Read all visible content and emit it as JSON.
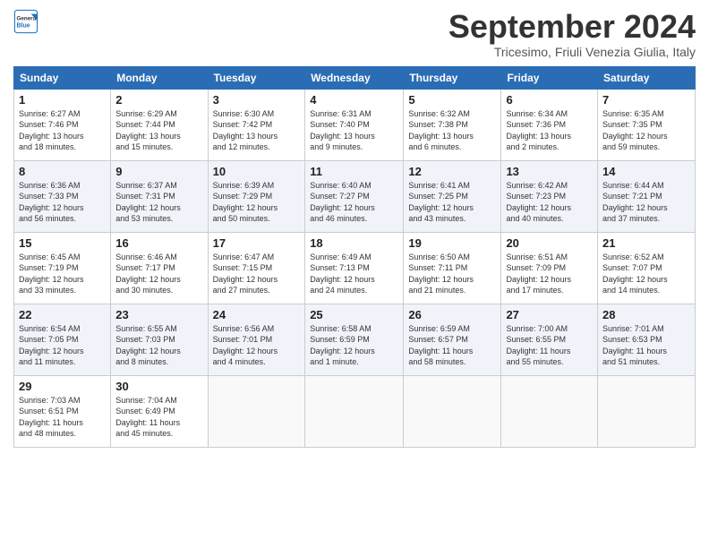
{
  "header": {
    "logo_line1": "General",
    "logo_line2": "Blue",
    "month": "September 2024",
    "location": "Tricesimo, Friuli Venezia Giulia, Italy"
  },
  "days_of_week": [
    "Sunday",
    "Monday",
    "Tuesday",
    "Wednesday",
    "Thursday",
    "Friday",
    "Saturday"
  ],
  "weeks": [
    [
      {
        "day": "1",
        "lines": [
          "Sunrise: 6:27 AM",
          "Sunset: 7:46 PM",
          "Daylight: 13 hours",
          "and 18 minutes."
        ]
      },
      {
        "day": "2",
        "lines": [
          "Sunrise: 6:29 AM",
          "Sunset: 7:44 PM",
          "Daylight: 13 hours",
          "and 15 minutes."
        ]
      },
      {
        "day": "3",
        "lines": [
          "Sunrise: 6:30 AM",
          "Sunset: 7:42 PM",
          "Daylight: 13 hours",
          "and 12 minutes."
        ]
      },
      {
        "day": "4",
        "lines": [
          "Sunrise: 6:31 AM",
          "Sunset: 7:40 PM",
          "Daylight: 13 hours",
          "and 9 minutes."
        ]
      },
      {
        "day": "5",
        "lines": [
          "Sunrise: 6:32 AM",
          "Sunset: 7:38 PM",
          "Daylight: 13 hours",
          "and 6 minutes."
        ]
      },
      {
        "day": "6",
        "lines": [
          "Sunrise: 6:34 AM",
          "Sunset: 7:36 PM",
          "Daylight: 13 hours",
          "and 2 minutes."
        ]
      },
      {
        "day": "7",
        "lines": [
          "Sunrise: 6:35 AM",
          "Sunset: 7:35 PM",
          "Daylight: 12 hours",
          "and 59 minutes."
        ]
      }
    ],
    [
      {
        "day": "8",
        "lines": [
          "Sunrise: 6:36 AM",
          "Sunset: 7:33 PM",
          "Daylight: 12 hours",
          "and 56 minutes."
        ]
      },
      {
        "day": "9",
        "lines": [
          "Sunrise: 6:37 AM",
          "Sunset: 7:31 PM",
          "Daylight: 12 hours",
          "and 53 minutes."
        ]
      },
      {
        "day": "10",
        "lines": [
          "Sunrise: 6:39 AM",
          "Sunset: 7:29 PM",
          "Daylight: 12 hours",
          "and 50 minutes."
        ]
      },
      {
        "day": "11",
        "lines": [
          "Sunrise: 6:40 AM",
          "Sunset: 7:27 PM",
          "Daylight: 12 hours",
          "and 46 minutes."
        ]
      },
      {
        "day": "12",
        "lines": [
          "Sunrise: 6:41 AM",
          "Sunset: 7:25 PM",
          "Daylight: 12 hours",
          "and 43 minutes."
        ]
      },
      {
        "day": "13",
        "lines": [
          "Sunrise: 6:42 AM",
          "Sunset: 7:23 PM",
          "Daylight: 12 hours",
          "and 40 minutes."
        ]
      },
      {
        "day": "14",
        "lines": [
          "Sunrise: 6:44 AM",
          "Sunset: 7:21 PM",
          "Daylight: 12 hours",
          "and 37 minutes."
        ]
      }
    ],
    [
      {
        "day": "15",
        "lines": [
          "Sunrise: 6:45 AM",
          "Sunset: 7:19 PM",
          "Daylight: 12 hours",
          "and 33 minutes."
        ]
      },
      {
        "day": "16",
        "lines": [
          "Sunrise: 6:46 AM",
          "Sunset: 7:17 PM",
          "Daylight: 12 hours",
          "and 30 minutes."
        ]
      },
      {
        "day": "17",
        "lines": [
          "Sunrise: 6:47 AM",
          "Sunset: 7:15 PM",
          "Daylight: 12 hours",
          "and 27 minutes."
        ]
      },
      {
        "day": "18",
        "lines": [
          "Sunrise: 6:49 AM",
          "Sunset: 7:13 PM",
          "Daylight: 12 hours",
          "and 24 minutes."
        ]
      },
      {
        "day": "19",
        "lines": [
          "Sunrise: 6:50 AM",
          "Sunset: 7:11 PM",
          "Daylight: 12 hours",
          "and 21 minutes."
        ]
      },
      {
        "day": "20",
        "lines": [
          "Sunrise: 6:51 AM",
          "Sunset: 7:09 PM",
          "Daylight: 12 hours",
          "and 17 minutes."
        ]
      },
      {
        "day": "21",
        "lines": [
          "Sunrise: 6:52 AM",
          "Sunset: 7:07 PM",
          "Daylight: 12 hours",
          "and 14 minutes."
        ]
      }
    ],
    [
      {
        "day": "22",
        "lines": [
          "Sunrise: 6:54 AM",
          "Sunset: 7:05 PM",
          "Daylight: 12 hours",
          "and 11 minutes."
        ]
      },
      {
        "day": "23",
        "lines": [
          "Sunrise: 6:55 AM",
          "Sunset: 7:03 PM",
          "Daylight: 12 hours",
          "and 8 minutes."
        ]
      },
      {
        "day": "24",
        "lines": [
          "Sunrise: 6:56 AM",
          "Sunset: 7:01 PM",
          "Daylight: 12 hours",
          "and 4 minutes."
        ]
      },
      {
        "day": "25",
        "lines": [
          "Sunrise: 6:58 AM",
          "Sunset: 6:59 PM",
          "Daylight: 12 hours",
          "and 1 minute."
        ]
      },
      {
        "day": "26",
        "lines": [
          "Sunrise: 6:59 AM",
          "Sunset: 6:57 PM",
          "Daylight: 11 hours",
          "and 58 minutes."
        ]
      },
      {
        "day": "27",
        "lines": [
          "Sunrise: 7:00 AM",
          "Sunset: 6:55 PM",
          "Daylight: 11 hours",
          "and 55 minutes."
        ]
      },
      {
        "day": "28",
        "lines": [
          "Sunrise: 7:01 AM",
          "Sunset: 6:53 PM",
          "Daylight: 11 hours",
          "and 51 minutes."
        ]
      }
    ],
    [
      {
        "day": "29",
        "lines": [
          "Sunrise: 7:03 AM",
          "Sunset: 6:51 PM",
          "Daylight: 11 hours",
          "and 48 minutes."
        ]
      },
      {
        "day": "30",
        "lines": [
          "Sunrise: 7:04 AM",
          "Sunset: 6:49 PM",
          "Daylight: 11 hours",
          "and 45 minutes."
        ]
      },
      null,
      null,
      null,
      null,
      null
    ]
  ]
}
